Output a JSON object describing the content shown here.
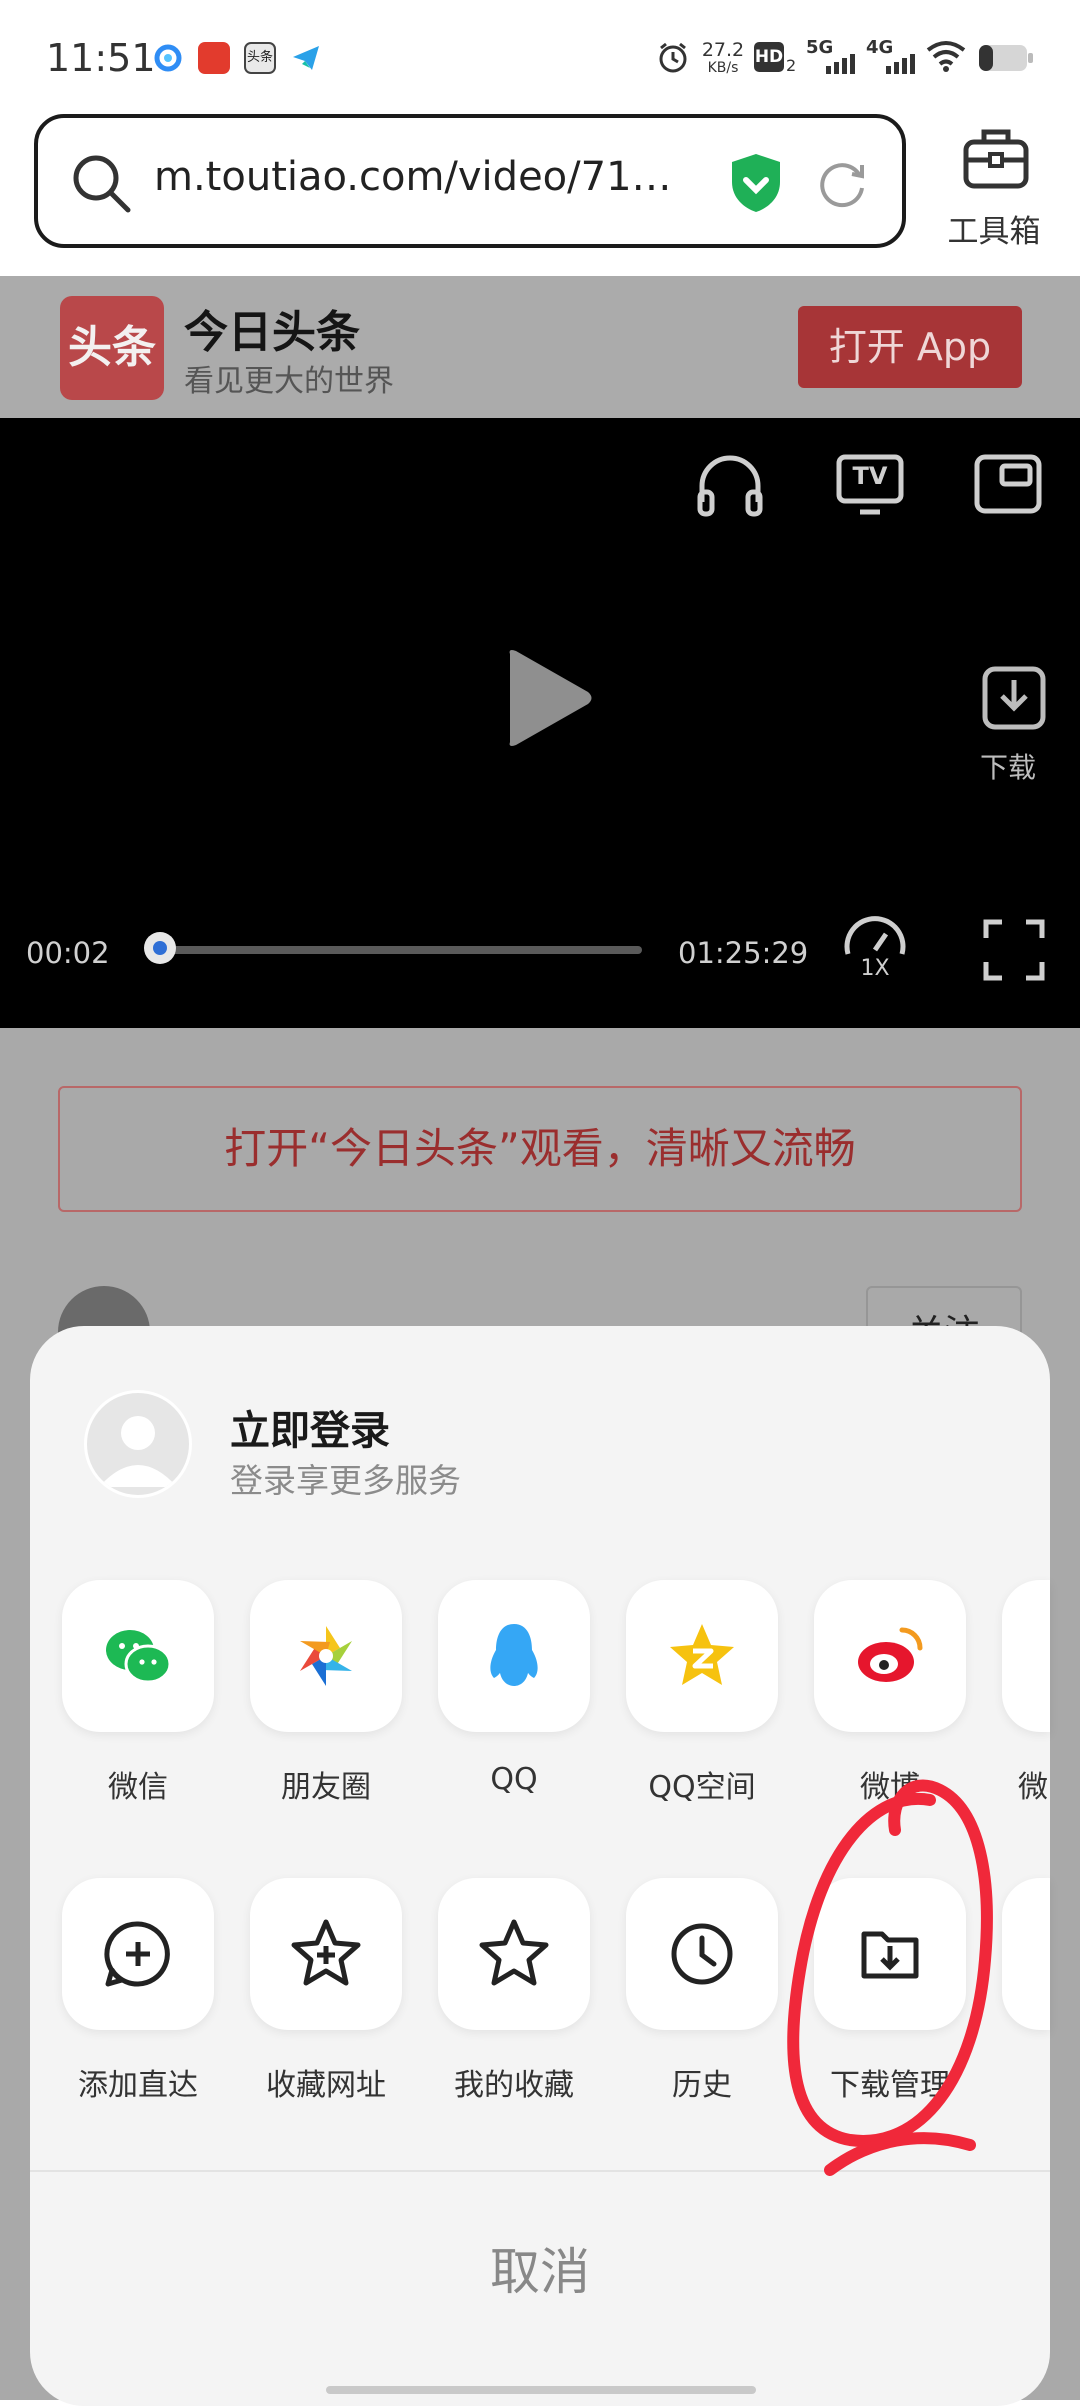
{
  "status_bar": {
    "time": "11:51",
    "net_speed_top": "27.2",
    "net_speed_unit": "KB/s",
    "hd": "HD",
    "hd_sub": "2",
    "sig1": "5G",
    "sig2": "4G",
    "mini_app_label": "头条"
  },
  "browser": {
    "url": "m.toutiao.com/video/71…",
    "toolbox_label": "工具箱"
  },
  "toutiao": {
    "logo_text": "头条",
    "name": "今日头条",
    "slogan": "看见更大的世界",
    "open_app": "打开 App"
  },
  "video": {
    "current_time": "00:02",
    "total_time": "01:25:29",
    "progress": 0.0,
    "tv_label": "TV",
    "speed_label": "1X",
    "download_label": "下载"
  },
  "watch_banner": "打开“今日头条”观看，清晰又流畅",
  "follow_label": "关注",
  "share_sheet": {
    "login_title": "立即登录",
    "login_sub": "登录享更多服务",
    "share_row": [
      {
        "label": "微信",
        "icon": "wechat-icon"
      },
      {
        "label": "朋友圈",
        "icon": "moments-icon"
      },
      {
        "label": "QQ",
        "icon": "qq-icon"
      },
      {
        "label": "QQ空间",
        "icon": "qzone-icon"
      },
      {
        "label": "微博",
        "icon": "weibo-icon"
      },
      {
        "label": "微",
        "icon": "partial-icon"
      }
    ],
    "action_row": [
      {
        "label": "添加直达",
        "icon": "add-shortcut-icon"
      },
      {
        "label": "收藏网址",
        "icon": "bookmark-add-icon"
      },
      {
        "label": "我的收藏",
        "icon": "star-icon"
      },
      {
        "label": "历史",
        "icon": "clock-icon"
      },
      {
        "label": "下载管理",
        "icon": "download-folder-icon"
      }
    ],
    "cancel": "取消"
  },
  "colors": {
    "accent_red": "#a73537",
    "wechat_green": "#1db954",
    "qq_blue": "#35a7f5",
    "qzone_yellow": "#f6c20f",
    "weibo_red": "#e6162d",
    "annotation_red": "#f0283a"
  }
}
